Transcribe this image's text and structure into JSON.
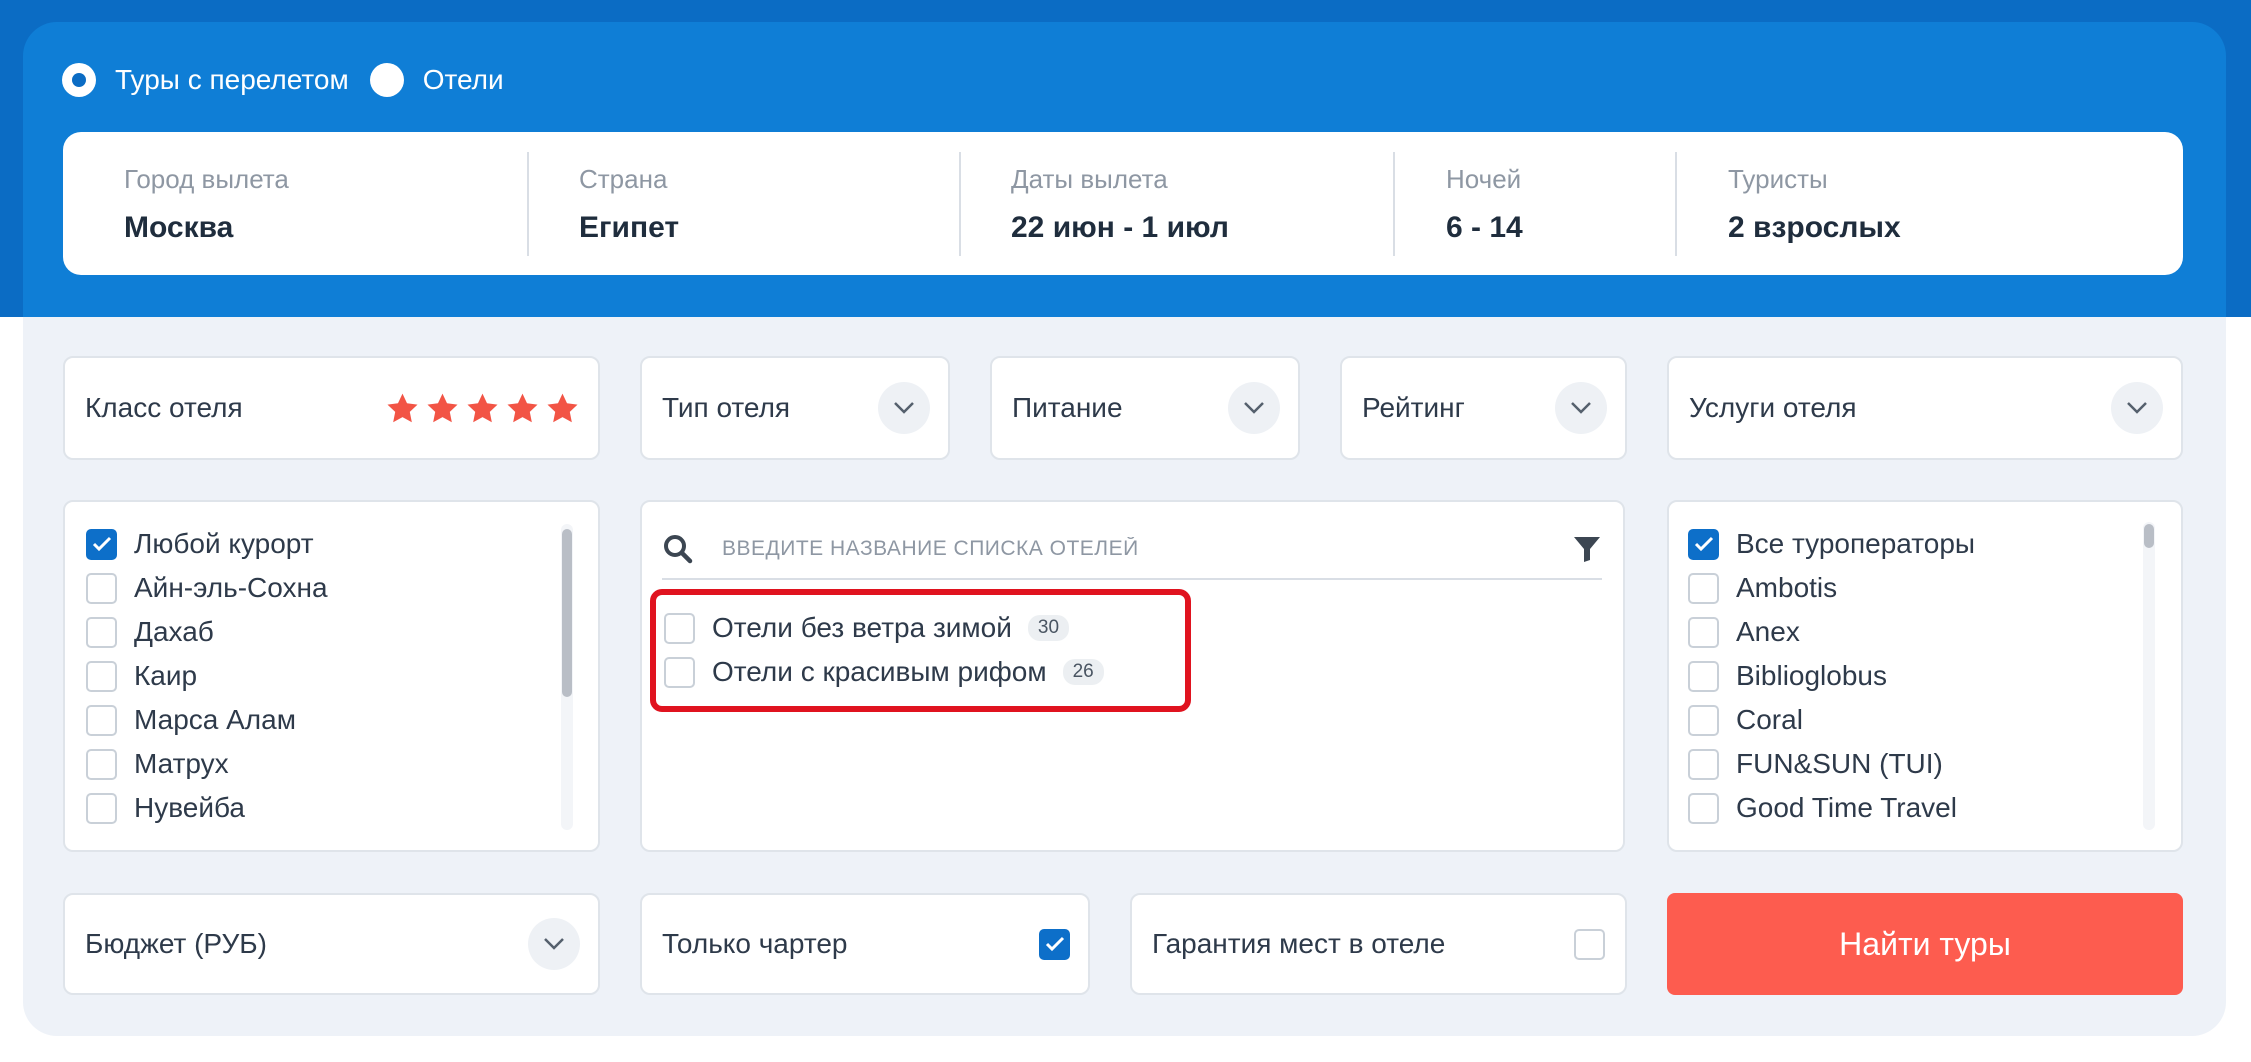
{
  "colors": {
    "brand_blue": "#0b6cc4",
    "header_blue": "#0f7ed6",
    "accent_red": "#fd5c4f",
    "star_red": "#f25445",
    "checkbox_blue": "#0d6fc9",
    "highlight_red": "#e0131f"
  },
  "mode": {
    "options": [
      {
        "label": "Туры с перелетом",
        "selected": true
      },
      {
        "label": "Отели",
        "selected": false
      }
    ]
  },
  "search": {
    "city": {
      "label": "Город вылета",
      "value": "Москва"
    },
    "country": {
      "label": "Страна",
      "value": "Египет"
    },
    "dates": {
      "label": "Даты вылета",
      "value": "22 июн - 1 июл"
    },
    "nights": {
      "label": "Ночей",
      "value": "6 - 14"
    },
    "tourists": {
      "label": "Туристы",
      "value": "2 взрослых"
    }
  },
  "filters": {
    "hotel_class": {
      "label": "Класс отеля",
      "stars": 5
    },
    "hotel_type": "Тип отеля",
    "meals": "Питание",
    "rating": "Рейтинг",
    "services": "Услуги отеля"
  },
  "resorts": [
    {
      "label": "Любой курорт",
      "checked": true
    },
    {
      "label": "Айн-эль-Сохна",
      "checked": false
    },
    {
      "label": "Дахаб",
      "checked": false
    },
    {
      "label": "Каир",
      "checked": false
    },
    {
      "label": "Марса Алам",
      "checked": false
    },
    {
      "label": "Матрух",
      "checked": false
    },
    {
      "label": "Нувейба",
      "checked": false
    }
  ],
  "hotel_lists": {
    "placeholder": "ВВЕДИТЕ НАЗВАНИЕ СПИСКА ОТЕЛЕЙ",
    "items": [
      {
        "label": "Отели без ветра зимой",
        "count": "30",
        "checked": false
      },
      {
        "label": "Отели с красивым рифом",
        "count": "26",
        "checked": false
      }
    ]
  },
  "operators": [
    {
      "label": "Все туроператоры",
      "checked": true
    },
    {
      "label": "Ambotis",
      "checked": false
    },
    {
      "label": "Anex",
      "checked": false
    },
    {
      "label": "Biblioglobus",
      "checked": false
    },
    {
      "label": "Coral",
      "checked": false
    },
    {
      "label": "FUN&SUN (TUI)",
      "checked": false
    },
    {
      "label": "Good Time Travel",
      "checked": false
    }
  ],
  "bottom": {
    "budget": "Бюджет (РУБ)",
    "charter": {
      "label": "Только чартер",
      "checked": true
    },
    "guarantee": {
      "label": "Гарантия мест в отеле",
      "checked": false
    },
    "submit": "Найти туры"
  }
}
